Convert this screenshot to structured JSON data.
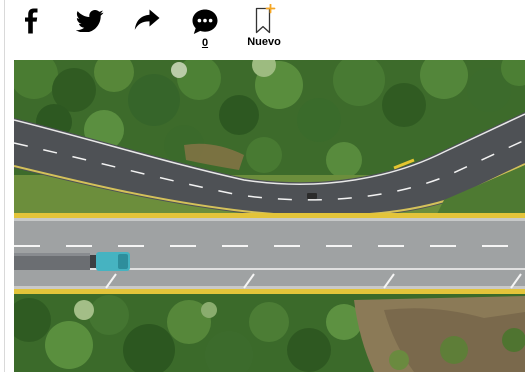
{
  "share_bar": {
    "facebook_icon": "facebook-icon",
    "twitter_icon": "twitter-icon",
    "share_icon": "share-arrow-icon",
    "comments_icon": "comment-bubble-icon",
    "comment_count": "0",
    "save_icon": "bookmark-plus-icon",
    "save_label": "Nuevo",
    "accent_color": "#f5a623"
  },
  "article": {
    "photo_icon": "aerial-highway-photo"
  }
}
